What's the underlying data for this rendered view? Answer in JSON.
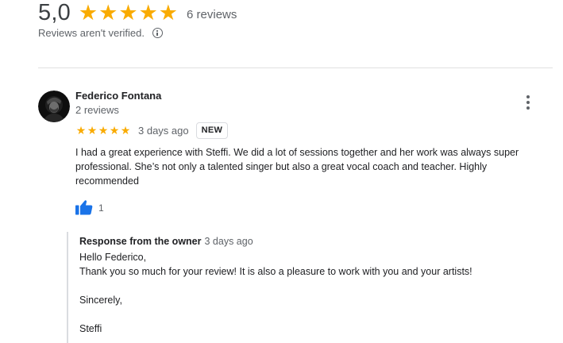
{
  "summary": {
    "average": "5,0",
    "stars_filled": 5,
    "review_count": "6 reviews",
    "verification_note": "Reviews aren't verified."
  },
  "review": {
    "author": "Federico Fontana",
    "author_reviews": "2 reviews",
    "rating": 5,
    "time_ago": "3 days ago",
    "badge": "NEW",
    "text": "I had a great experience with Steffi. We did a lot of sessions together and her work was always super professional. She’s not only a talented singer but also a great vocal coach and teacher. Highly recommended",
    "likes": "1"
  },
  "owner_response": {
    "title": "Response from the owner",
    "time_ago": "3 days ago",
    "lines": [
      "Hello Federico,",
      "Thank you so much for your review! It is also a pleasure to work with you and your artists!",
      "",
      "Sincerely,",
      "",
      "Steffi"
    ]
  },
  "colors": {
    "star": "#f9ab00",
    "like_blue": "#1a73e8",
    "muted_text": "#5f6368",
    "divider": "#e0e0e0"
  },
  "icons": {
    "star": "star-icon",
    "info": "info-icon",
    "more": "more-vert-icon",
    "like": "thumb-up-icon"
  }
}
